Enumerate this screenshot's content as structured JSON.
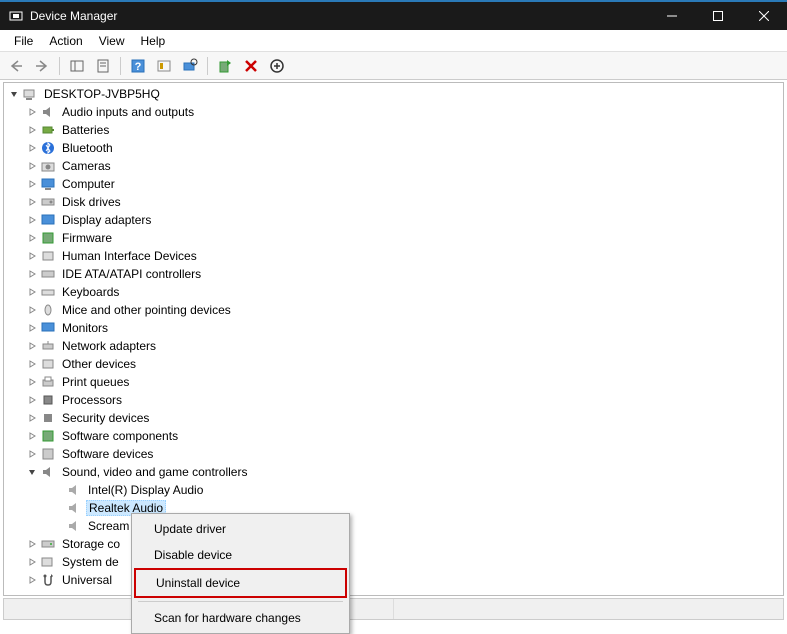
{
  "window": {
    "title": "Device Manager"
  },
  "menubar": [
    "File",
    "Action",
    "View",
    "Help"
  ],
  "tree": {
    "root": {
      "label": "DESKTOP-JVBP5HQ"
    },
    "categories": [
      {
        "label": "Audio inputs and outputs",
        "expanded": false
      },
      {
        "label": "Batteries",
        "expanded": false
      },
      {
        "label": "Bluetooth",
        "expanded": false
      },
      {
        "label": "Cameras",
        "expanded": false
      },
      {
        "label": "Computer",
        "expanded": false
      },
      {
        "label": "Disk drives",
        "expanded": false
      },
      {
        "label": "Display adapters",
        "expanded": false
      },
      {
        "label": "Firmware",
        "expanded": false
      },
      {
        "label": "Human Interface Devices",
        "expanded": false
      },
      {
        "label": "IDE ATA/ATAPI controllers",
        "expanded": false
      },
      {
        "label": "Keyboards",
        "expanded": false
      },
      {
        "label": "Mice and other pointing devices",
        "expanded": false
      },
      {
        "label": "Monitors",
        "expanded": false
      },
      {
        "label": "Network adapters",
        "expanded": false
      },
      {
        "label": "Other devices",
        "expanded": false
      },
      {
        "label": "Print queues",
        "expanded": false
      },
      {
        "label": "Processors",
        "expanded": false
      },
      {
        "label": "Security devices",
        "expanded": false
      },
      {
        "label": "Software components",
        "expanded": false
      },
      {
        "label": "Software devices",
        "expanded": false
      },
      {
        "label": "Sound, video and game controllers",
        "expanded": true,
        "children": [
          {
            "label": "Intel(R) Display Audio"
          },
          {
            "label": "Realtek Audio",
            "selected": true
          },
          {
            "label": "Scream"
          }
        ]
      },
      {
        "label": "Storage co"
      },
      {
        "label": "System de"
      },
      {
        "label": "Universal "
      }
    ]
  },
  "contextMenu": {
    "items": [
      {
        "label": "Update driver"
      },
      {
        "label": "Disable device"
      },
      {
        "label": "Uninstall device",
        "highlighted": true
      }
    ],
    "after_sep": [
      {
        "label": "Scan for hardware changes"
      }
    ]
  }
}
